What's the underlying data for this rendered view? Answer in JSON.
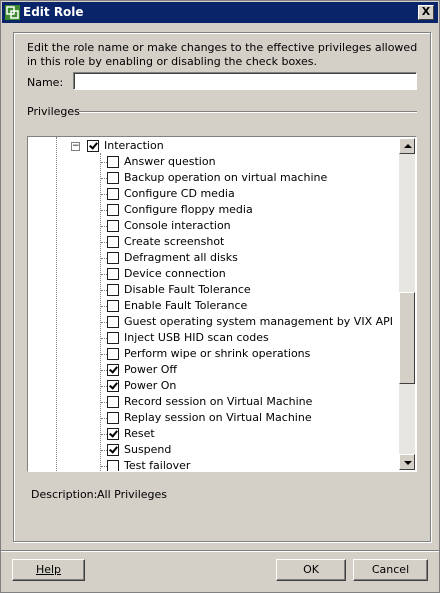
{
  "window": {
    "title": "Edit Role",
    "close_glyph": "X"
  },
  "intro_text": "Edit the role name or make changes to the effective privileges allowed in this role by enabling or disabling the check boxes.",
  "name": {
    "label": "Name:",
    "value": ""
  },
  "privileges_label": "Privileges",
  "tree": {
    "expander_glyph": "−",
    "parent": {
      "label": "Interaction",
      "checked": true
    },
    "items": [
      {
        "label": "Answer question",
        "checked": false
      },
      {
        "label": "Backup operation on virtual machine",
        "checked": false
      },
      {
        "label": "Configure CD media",
        "checked": false
      },
      {
        "label": "Configure floppy media",
        "checked": false
      },
      {
        "label": "Console interaction",
        "checked": false
      },
      {
        "label": "Create screenshot",
        "checked": false
      },
      {
        "label": "Defragment all disks",
        "checked": false
      },
      {
        "label": "Device connection",
        "checked": false
      },
      {
        "label": "Disable Fault Tolerance",
        "checked": false
      },
      {
        "label": "Enable Fault Tolerance",
        "checked": false
      },
      {
        "label": "Guest operating system management by VIX API",
        "checked": false
      },
      {
        "label": "Inject USB HID scan codes",
        "checked": false
      },
      {
        "label": "Perform wipe or shrink operations",
        "checked": false
      },
      {
        "label": "Power Off",
        "checked": true
      },
      {
        "label": "Power On",
        "checked": true
      },
      {
        "label": "Record session on Virtual Machine",
        "checked": false
      },
      {
        "label": "Replay session on Virtual Machine",
        "checked": false
      },
      {
        "label": "Reset",
        "checked": true
      },
      {
        "label": "Suspend",
        "checked": true
      },
      {
        "label": "Test failover",
        "checked": false
      }
    ]
  },
  "description": {
    "label": "Description:",
    "value": "All Privileges"
  },
  "buttons": {
    "help": "Help",
    "ok": "OK",
    "cancel": "Cancel"
  }
}
